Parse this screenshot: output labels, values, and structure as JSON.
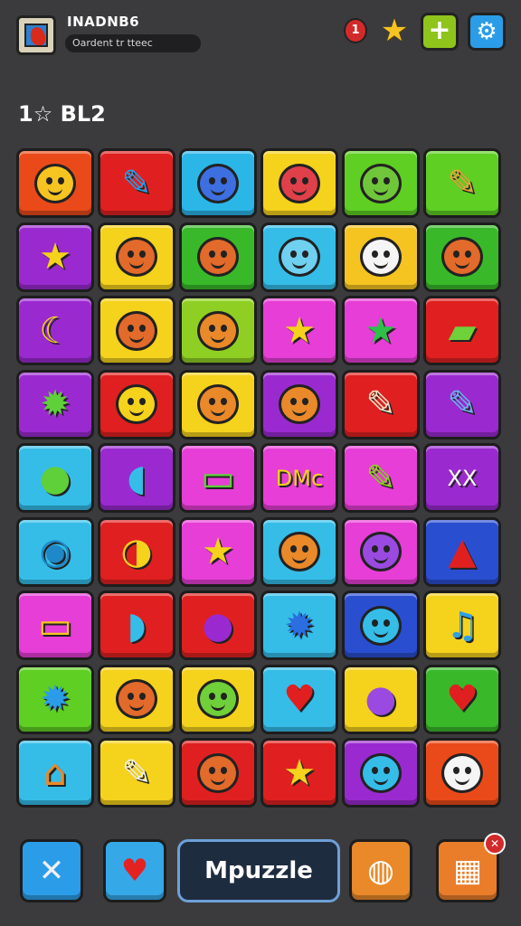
{
  "header": {
    "title": "INADNB6",
    "subtitle": "Oardent tr tteec",
    "alert_count": "1",
    "star_icon": "★",
    "add_icon": "+",
    "settings_icon": "⚙"
  },
  "score": "1☆ BL2",
  "grid": {
    "rows": [
      [
        {
          "bg": "#ea4a1a",
          "glyph": "face",
          "face": "#f5c421"
        },
        {
          "bg": "#e02020",
          "glyph": "✎",
          "color": "#2b9de8"
        },
        {
          "bg": "#2bb6e8",
          "glyph": "face",
          "face": "#3d6fe0"
        },
        {
          "bg": "#f5d21c",
          "glyph": "face",
          "face": "#e0404a"
        },
        {
          "bg": "#5fcf23",
          "glyph": "face",
          "face": "#6fc63a"
        },
        {
          "bg": "#5fcf23",
          "glyph": "✎",
          "color": "#e9a43a"
        }
      ],
      [
        {
          "bg": "#9a2ad0",
          "glyph": "★",
          "color": "#f5d21c"
        },
        {
          "bg": "#f5d21c",
          "glyph": "face",
          "face": "#e26a2a"
        },
        {
          "bg": "#39b92a",
          "glyph": "face",
          "face": "#e26a2a"
        },
        {
          "bg": "#35bde8",
          "glyph": "face",
          "face": "#6fd0f0"
        },
        {
          "bg": "#f5c421",
          "glyph": "face",
          "face": "#f5f5f5"
        },
        {
          "bg": "#39b92a",
          "glyph": "face",
          "face": "#e26a2a"
        }
      ],
      [
        {
          "bg": "#9a2ad0",
          "glyph": "☾",
          "color": "#f5d21c"
        },
        {
          "bg": "#f5d21c",
          "glyph": "face",
          "face": "#e26a2a"
        },
        {
          "bg": "#8fcf23",
          "glyph": "face",
          "face": "#e9892a"
        },
        {
          "bg": "#e63ed6",
          "glyph": "★",
          "color": "#f5d21c"
        },
        {
          "bg": "#e63ed6",
          "glyph": "★",
          "color": "#2fbf4a"
        },
        {
          "bg": "#e02020",
          "glyph": "▰",
          "color": "#6fd03a"
        }
      ],
      [
        {
          "bg": "#9a2ad0",
          "glyph": "✹",
          "color": "#5fcf3a"
        },
        {
          "bg": "#e02020",
          "glyph": "face",
          "face": "#f5d21c"
        },
        {
          "bg": "#f5d21c",
          "glyph": "face",
          "face": "#e9892a"
        },
        {
          "bg": "#9a2ad0",
          "glyph": "face",
          "face": "#e9892a"
        },
        {
          "bg": "#e02020",
          "glyph": "✎",
          "color": "#f0e0c0"
        },
        {
          "bg": "#9a2ad0",
          "glyph": "✎",
          "color": "#6fb0f0"
        }
      ],
      [
        {
          "bg": "#35bde8",
          "glyph": "●",
          "color": "#5fcf3a"
        },
        {
          "bg": "#9a2ad0",
          "glyph": "◖",
          "color": "#35bde8"
        },
        {
          "bg": "#e63ed6",
          "glyph": "▭",
          "color": "#5fcf3a"
        },
        {
          "bg": "#e63ed6",
          "glyph": "DMc",
          "color": "#f5d21c",
          "small": true
        },
        {
          "bg": "#e63ed6",
          "glyph": "✎",
          "color": "#8fcf23"
        },
        {
          "bg": "#9a2ad0",
          "glyph": "XX",
          "color": "#ffffff",
          "small": true
        }
      ],
      [
        {
          "bg": "#35bde8",
          "glyph": "◉",
          "color": "#1e88c8"
        },
        {
          "bg": "#e02020",
          "glyph": "◑",
          "color": "#f5d21c"
        },
        {
          "bg": "#e63ed6",
          "glyph": "★",
          "color": "#f5d21c"
        },
        {
          "bg": "#35bde8",
          "glyph": "face",
          "face": "#e9892a"
        },
        {
          "bg": "#e63ed6",
          "glyph": "face",
          "face": "#9a4ae0"
        },
        {
          "bg": "#2a4ed0",
          "glyph": "▲",
          "color": "#e02020"
        }
      ],
      [
        {
          "bg": "#e63ed6",
          "glyph": "▭",
          "color": "#f5c421"
        },
        {
          "bg": "#e02020",
          "glyph": "◗",
          "color": "#35bde8"
        },
        {
          "bg": "#e02020",
          "glyph": "●",
          "color": "#9a2ad0"
        },
        {
          "bg": "#35bde8",
          "glyph": "✹",
          "color": "#2a6ee0"
        },
        {
          "bg": "#2a4ed0",
          "glyph": "face",
          "face": "#35bde8"
        },
        {
          "bg": "#f5d21c",
          "glyph": "♫",
          "color": "#2fa0e0"
        }
      ],
      [
        {
          "bg": "#5fcf23",
          "glyph": "✹",
          "color": "#2b9de8"
        },
        {
          "bg": "#f5d21c",
          "glyph": "face",
          "face": "#e26a2a"
        },
        {
          "bg": "#f5d21c",
          "glyph": "face",
          "face": "#6fd03a"
        },
        {
          "bg": "#35bde8",
          "glyph": "♥",
          "color": "#e02020"
        },
        {
          "bg": "#f5d21c",
          "glyph": "●",
          "color": "#9a4ae0"
        },
        {
          "bg": "#39b92a",
          "glyph": "♥",
          "color": "#e02020"
        }
      ],
      [
        {
          "bg": "#35bde8",
          "glyph": "⌂",
          "color": "#e9892a"
        },
        {
          "bg": "#f5d21c",
          "glyph": "✎",
          "color": "#f5f5e0"
        },
        {
          "bg": "#e02020",
          "glyph": "face",
          "face": "#e26a2a"
        },
        {
          "bg": "#e02020",
          "glyph": "★",
          "color": "#f5d21c"
        },
        {
          "bg": "#9a2ad0",
          "glyph": "face",
          "face": "#35bde8"
        },
        {
          "bg": "#ea4a1a",
          "glyph": "face",
          "face": "#f5f5f5"
        }
      ]
    ]
  },
  "bottom": {
    "tools_icon": "✕",
    "heart_icon": "♥",
    "center_label": "Mpuzzle",
    "profile_icon": "◍",
    "grid_icon": "▦",
    "grid_badge": "✕"
  }
}
